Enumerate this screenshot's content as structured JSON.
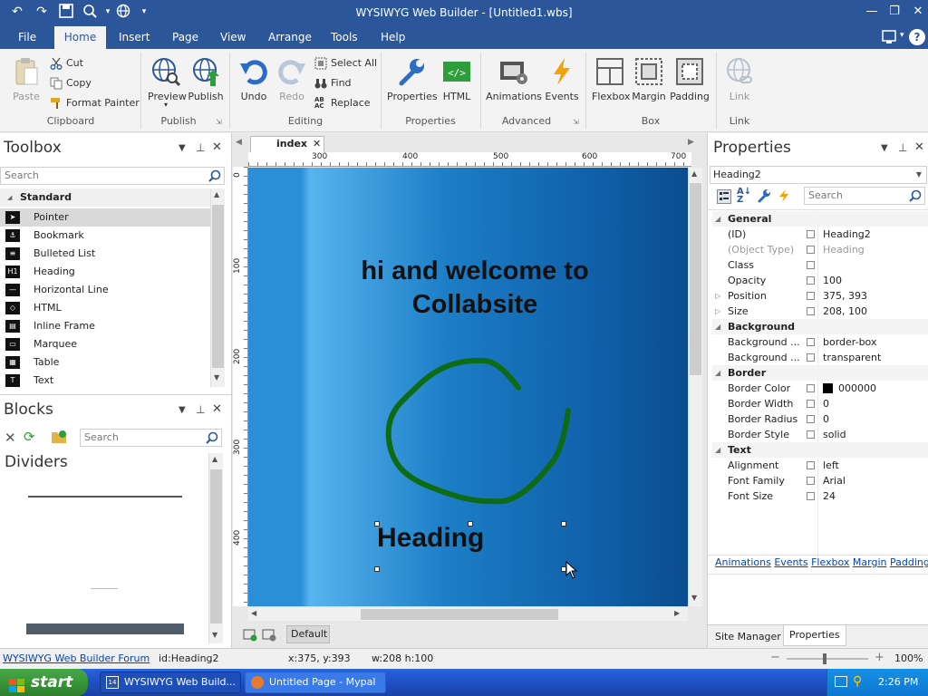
{
  "window": {
    "title": "WYSIWYG Web Builder - [Untitled1.wbs]"
  },
  "menu_tabs": [
    "File",
    "Home",
    "Insert",
    "Page",
    "View",
    "Arrange",
    "Tools",
    "Help"
  ],
  "ribbon": {
    "paste": "Paste",
    "cut": "Cut",
    "copy": "Copy",
    "format_painter": "Format Painter",
    "preview": "Preview",
    "publish": "Publish",
    "undo": "Undo",
    "redo": "Redo",
    "select_all": "Select All",
    "find": "Find",
    "replace": "Replace",
    "properties": "Properties",
    "html": "HTML",
    "animations": "Animations",
    "events": "Events",
    "flexbox": "Flexbox",
    "margin": "Margin",
    "padding": "Padding",
    "link": "Link",
    "groups": [
      "Clipboard",
      "Publish",
      "Editing",
      "Properties",
      "Advanced",
      "Box",
      "Link"
    ]
  },
  "toolbox": {
    "title": "Toolbox",
    "search_placeholder": "Search",
    "category": "Standard",
    "items": [
      {
        "label": "Pointer",
        "icon": "pointer-icon"
      },
      {
        "label": "Bookmark",
        "icon": "bookmark-icon"
      },
      {
        "label": "Bulleted List",
        "icon": "bulleted-list-icon"
      },
      {
        "label": "Heading",
        "icon": "heading-icon"
      },
      {
        "label": "Horizontal Line",
        "icon": "horizontal-line-icon"
      },
      {
        "label": "HTML",
        "icon": "html-icon"
      },
      {
        "label": "Inline Frame",
        "icon": "inline-frame-icon"
      },
      {
        "label": "Marquee",
        "icon": "marquee-icon"
      },
      {
        "label": "Table",
        "icon": "table-icon"
      },
      {
        "label": "Text",
        "icon": "text-icon"
      }
    ]
  },
  "blocks": {
    "title": "Blocks",
    "search_placeholder": "Search",
    "category": "Dividers"
  },
  "document": {
    "tab": "index",
    "ruler_h": [
      "300",
      "400",
      "500",
      "600",
      "700"
    ],
    "ruler_v": [
      "0",
      "100",
      "200",
      "300",
      "400"
    ],
    "welcome_line1": "hi and welcome to",
    "welcome_line2": "Collabsite",
    "heading": "Heading",
    "layer": "Default"
  },
  "properties": {
    "title": "Properties",
    "object": "Heading2",
    "search_placeholder": "Search",
    "rows": [
      {
        "type": "cat",
        "key": "General"
      },
      {
        "key": "(ID)",
        "value": "Heading2"
      },
      {
        "key": "(Object Type)",
        "value": "Heading",
        "dim": true
      },
      {
        "key": "Class",
        "value": ""
      },
      {
        "key": "Opacity",
        "value": "100"
      },
      {
        "key": "Position",
        "value": "375, 393",
        "expand": true
      },
      {
        "key": "Size",
        "value": "208, 100",
        "expand": true
      },
      {
        "type": "cat",
        "key": "Background"
      },
      {
        "key": "Background ...",
        "value": "border-box"
      },
      {
        "key": "Background ...",
        "value": "transparent"
      },
      {
        "type": "cat",
        "key": "Border"
      },
      {
        "key": "Border Color",
        "value": "000000",
        "swatch": "#000000"
      },
      {
        "key": "Border Width",
        "value": "0"
      },
      {
        "key": "Border Radius",
        "value": "0"
      },
      {
        "key": "Border Style",
        "value": "solid"
      },
      {
        "type": "cat",
        "key": "Text"
      },
      {
        "key": "Alignment",
        "value": "left"
      },
      {
        "key": "Font Family",
        "value": "Arial"
      },
      {
        "key": "Font Size",
        "value": "24"
      }
    ],
    "links": [
      "Animations",
      "Events",
      "Flexbox",
      "Margin",
      "Padding"
    ],
    "bottom_tabs": [
      "Site Manager",
      "Properties"
    ]
  },
  "status": {
    "forum": "WYSIWYG Web Builder Forum",
    "id": "id:Heading2",
    "pos": "x:375, y:393",
    "size": "w:208 h:100",
    "zoom": "100%"
  },
  "taskbar": {
    "start": "start",
    "task1": "WYSIWYG Web Build...",
    "task2": "Untitled Page - Mypal",
    "clock": "2:26 PM"
  },
  "colors": {
    "accent": "#2b579a",
    "canvas_blue": "#1b7fc4",
    "curve_green": "#0d6b14"
  }
}
